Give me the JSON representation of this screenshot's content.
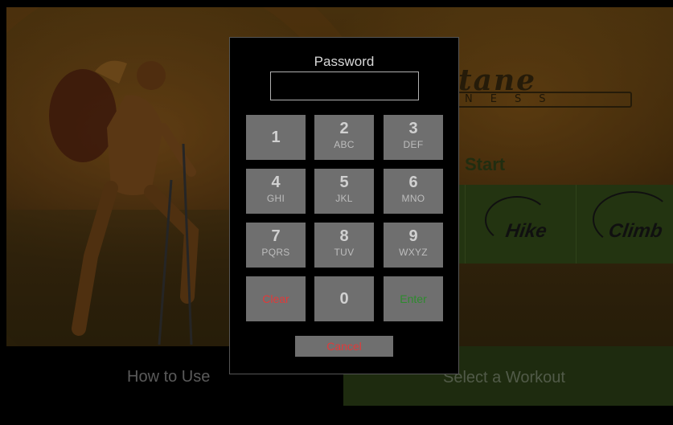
{
  "brand": {
    "word": "tane",
    "sub": "NESS"
  },
  "quick_start": {
    "label": "Start"
  },
  "workouts": [
    {
      "label": "Hike"
    },
    {
      "label": "Climb"
    }
  ],
  "bottom": {
    "how_to_use": "How to Use",
    "select_workout": "Select a Workout"
  },
  "dialog": {
    "title": "Password",
    "password_value": "",
    "keys": [
      {
        "digit": "1",
        "letters": ""
      },
      {
        "digit": "2",
        "letters": "ABC"
      },
      {
        "digit": "3",
        "letters": "DEF"
      },
      {
        "digit": "4",
        "letters": "GHI"
      },
      {
        "digit": "5",
        "letters": "JKL"
      },
      {
        "digit": "6",
        "letters": "MNO"
      },
      {
        "digit": "7",
        "letters": "PQRS"
      },
      {
        "digit": "8",
        "letters": "TUV"
      },
      {
        "digit": "9",
        "letters": "WXYZ"
      },
      {
        "label": "Clear"
      },
      {
        "digit": "0",
        "letters": ""
      },
      {
        "label": "Enter"
      }
    ],
    "cancel_label": "Cancel"
  },
  "colors": {
    "key_bg": "#6f6f6f",
    "clear_text": "#e03a3a",
    "enter_text": "#2e8b2e",
    "cancel_text": "#e03a3a",
    "workout_strip": "#37501b"
  }
}
